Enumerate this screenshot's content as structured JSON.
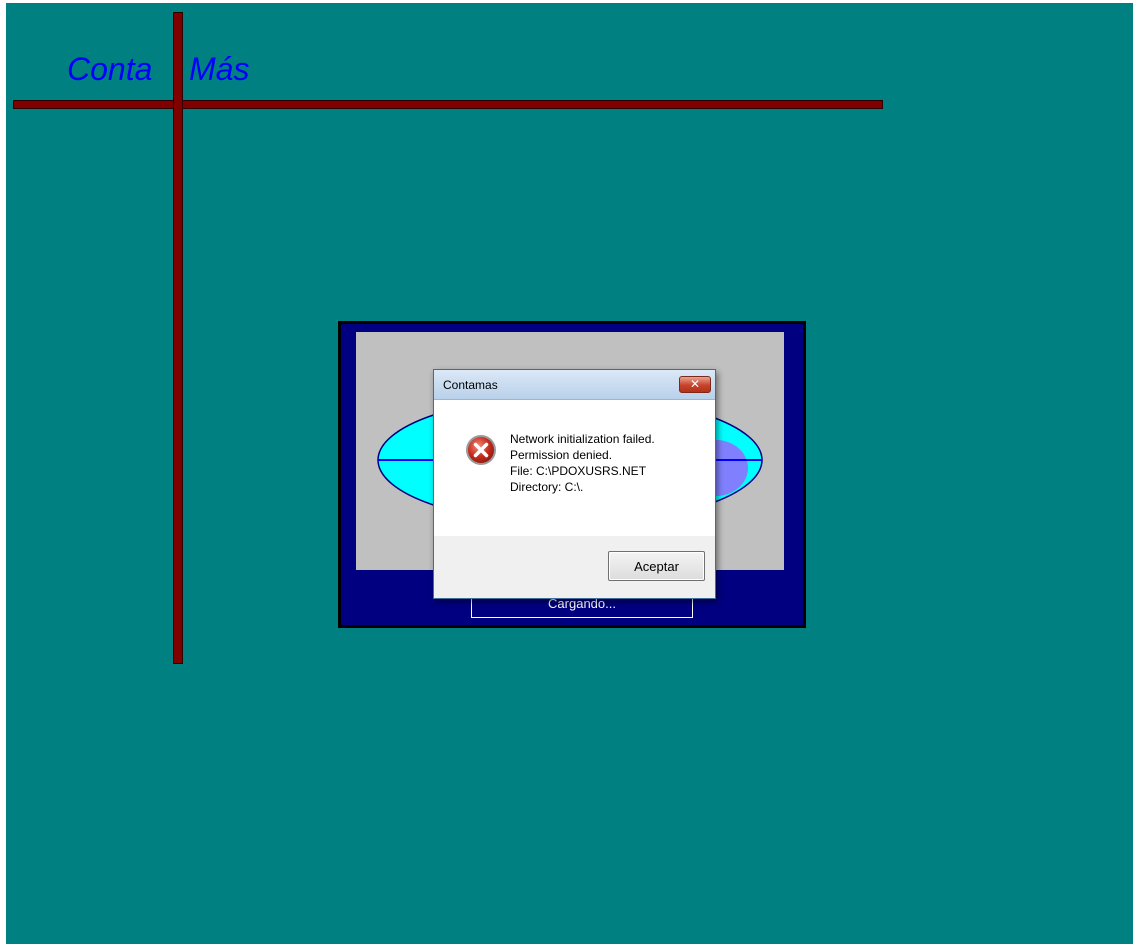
{
  "desktop": {
    "logo": {
      "part1": "Conta",
      "part2": "Más"
    }
  },
  "splash": {
    "loading_text": "Cargando..."
  },
  "dialog": {
    "title": "Contamas",
    "close_glyph": "✕",
    "icon": "error-icon",
    "message_lines": [
      "Network initialization failed.",
      "Permission denied.",
      "File: C:\\PDOXUSRS.NET",
      "Directory: C:\\."
    ],
    "ok_label": "Aceptar"
  },
  "colors": {
    "desktop": "#008080",
    "logo": "#0000ff",
    "bars": "#800000",
    "splash_frame": "#000080",
    "splash_panel": "#c0c0c0",
    "ellipse": "#00ffff",
    "error_red": "#c42b1c"
  }
}
